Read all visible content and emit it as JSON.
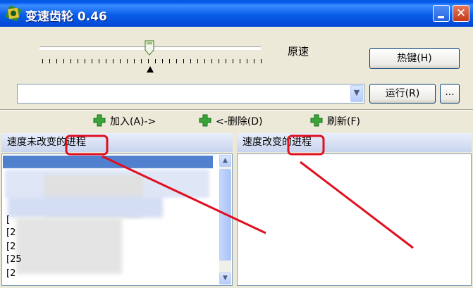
{
  "window": {
    "title": "变速齿轮 0.46",
    "minimize_icon": "minimize-icon",
    "close_glyph": "✕"
  },
  "speed": {
    "label": "原速",
    "level_fraction": 0.5
  },
  "buttons": {
    "hotkey": "热键(H)",
    "run": "运行(R)",
    "more": "..."
  },
  "process_combo": {
    "value": "",
    "arrow_glyph": "▼"
  },
  "actions": {
    "add": "加入(A)->",
    "remove": "<-删除(D)",
    "refresh": "刷新(F)"
  },
  "panels": {
    "left_title": "速度未改变的进程",
    "right_title": "速度改变的进程",
    "left_items": [
      "[2",
      "[2",
      "[2"
    ],
    "left_items_partial": [
      "[",
      "[25"
    ],
    "scroll_up": "▲",
    "scroll_down": "▼"
  },
  "colors": {
    "titlebar": "#0a5ee8",
    "annotation_red": "#e01020",
    "button_border": "#003c74"
  }
}
